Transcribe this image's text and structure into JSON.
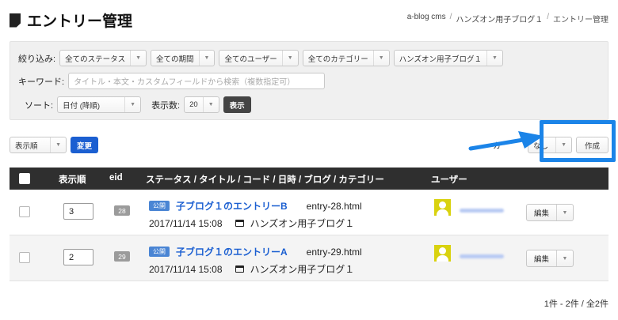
{
  "header": {
    "title": "エントリー管理",
    "breadcrumb": [
      "a-blog cms",
      "ハンズオン用子ブログ１",
      "エントリー管理"
    ]
  },
  "filter": {
    "narrow_label": "絞り込み:",
    "status": "全てのステータス",
    "period": "全ての期間",
    "user": "全てのユーザー",
    "category": "全てのカテゴリー",
    "blog": "ハンズオン用子ブログ１",
    "keyword_label": "キーワード:",
    "keyword_placeholder": "タイトル・本文・カスタムフィールドから検索（複数指定可）",
    "sort_label": "ソート:",
    "sort_value": "日付 (降順)",
    "count_label": "表示数:",
    "count_value": "20",
    "show_button": "表示"
  },
  "actions": {
    "order_select": "表示順",
    "change_button": "変更",
    "partial_label": "カ",
    "category_select": "なし",
    "create_button": "作成"
  },
  "table": {
    "headers": {
      "order": "表示順",
      "eid": "eid",
      "main": "ステータス / タイトル / コード / 日時 / ブログ / カテゴリー",
      "user": "ユーザー"
    },
    "rows": [
      {
        "order": "3",
        "eid": "28",
        "status": "公開",
        "title": "子ブログ１のエントリーB",
        "code": "entry-28.html",
        "datetime": "2017/11/14 15:08",
        "blog": "ハンズオン用子ブログ１",
        "edit": "編集"
      },
      {
        "order": "2",
        "eid": "29",
        "status": "公開",
        "title": "子ブログ１のエントリーA",
        "code": "entry-29.html",
        "datetime": "2017/11/14 15:08",
        "blog": "ハンズオン用子ブログ１",
        "edit": "編集"
      }
    ]
  },
  "pager": {
    "summary": "1件 - 2件 / 全2件"
  },
  "colors": {
    "accent_blue": "#1b5fd1",
    "annotation_blue": "#1b84e8",
    "avatar_yellow": "#d9d20f",
    "table_header": "#2f2f2f"
  }
}
